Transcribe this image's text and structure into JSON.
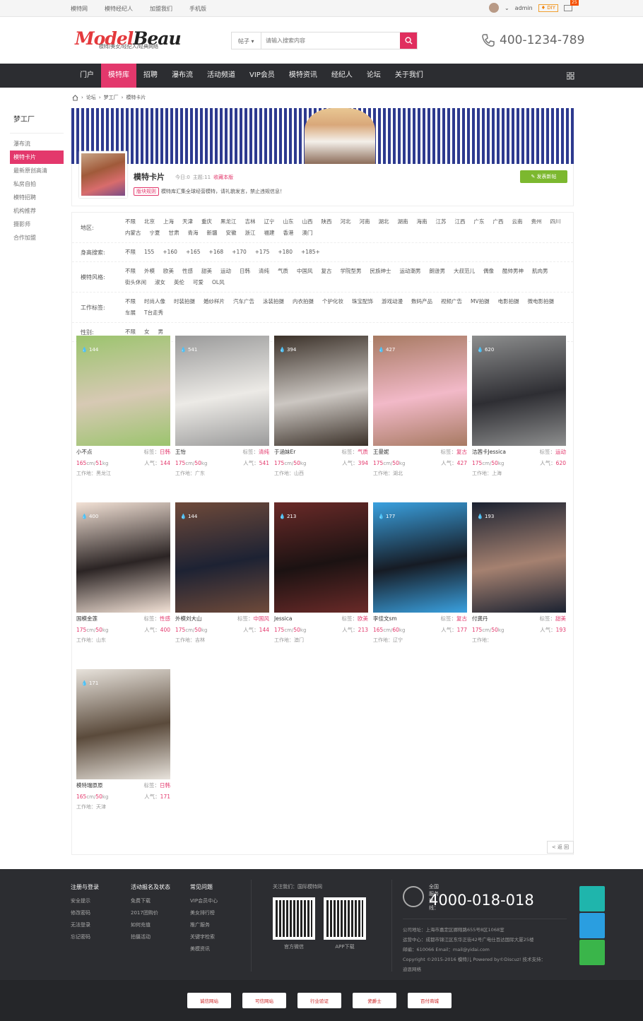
{
  "topbar": {
    "links": [
      "模特网",
      "模特经纪人",
      "加盟我们",
      "手机版"
    ],
    "user": "admin",
    "diy": "DIY",
    "mail_count": "25"
  },
  "header": {
    "logo": "ModelBeau",
    "logo_a": "Model",
    "logo_b": "Beau",
    "tagline": "模特/美女/经纪人/经典网络",
    "search_type": "帖子",
    "search_placeholder": "请输入搜索内容",
    "phone": "400-1234-789"
  },
  "nav": [
    "门户",
    "模特库",
    "招聘",
    "瀑布流",
    "活动频道",
    "VIP会员",
    "模特资讯",
    "经纪人",
    "论坛",
    "关于我们"
  ],
  "sidebar": {
    "title": "梦工厂",
    "items": [
      "瀑布流",
      "模特卡片",
      "最新原创高清",
      "私房自拍",
      "模特招聘",
      "机构推荐",
      "摄影师",
      "合作加盟"
    ]
  },
  "breadcrumb": [
    "论坛",
    "梦工厂",
    "模特卡片"
  ],
  "forum": {
    "title": "模特卡片",
    "today": "今日:0",
    "topics": "主题:11",
    "fav": "收藏本版",
    "rules_tag": "版块规则",
    "rules": "模特库汇集全球经营模特，请礼貌发言，禁止违规信息！",
    "post_btn": "发表新帖"
  },
  "filters": [
    {
      "label": "地区:",
      "opts": [
        "不限",
        "北京",
        "上海",
        "天津",
        "重庆",
        "黑龙江",
        "吉林",
        "辽宁",
        "山东",
        "山西",
        "陕西",
        "河北",
        "河南",
        "湖北",
        "湖南",
        "海南",
        "江苏",
        "江西",
        "广东",
        "广西",
        "云南",
        "贵州",
        "四川",
        "内蒙古",
        "宁夏",
        "甘肃",
        "青海",
        "新疆",
        "安徽",
        "浙江",
        "福建",
        "香港",
        "澳门"
      ]
    },
    {
      "label": "身高搜索:",
      "opts": [
        "不限",
        "155",
        "+160",
        "+165",
        "+168",
        "+170",
        "+175",
        "+180",
        "+185+"
      ]
    },
    {
      "label": "模特风格:",
      "opts": [
        "不限",
        "外模",
        "欧美",
        "性感",
        "甜美",
        "运动",
        "日韩",
        "清纯",
        "气质",
        "中国风",
        "复古",
        "学院型男",
        "民族绅士",
        "运动潮男",
        "朗逊男",
        "大叔范儿",
        "偶像",
        "酷帅男神",
        "肌肉男",
        "街头休闲",
        "淑女",
        "英伦",
        "可爱",
        "OL风"
      ]
    },
    {
      "label": "工作标签:",
      "opts": [
        "不限",
        "时尚人像",
        "时装拍摄",
        "婚纱样片",
        "汽车广告",
        "泳装拍摄",
        "内衣拍摄",
        "个护化妆",
        "珠宝配饰",
        "游戏动漫",
        "数码产品",
        "视频广告",
        "MV拍摄",
        "电影拍摄",
        "微电影拍摄",
        "车展",
        "T台走秀"
      ]
    },
    {
      "label": "性别:",
      "opts": [
        "不限",
        "女",
        "男"
      ]
    }
  ],
  "cards": [
    {
      "likes": "144",
      "name": "小不点",
      "tag_label": "标签：",
      "tag": "日韩",
      "h": "165",
      "w": "51",
      "pop_label": "人气：",
      "pop": "144",
      "area": "工作地：黑龙江",
      "c1": "#9bc46d",
      "c2": "#d7c9b4"
    },
    {
      "likes": "541",
      "name": "王怡",
      "tag_label": "标签：",
      "tag": "清纯",
      "h": "175",
      "w": "50",
      "pop_label": "人气：",
      "pop": "541",
      "area": "工作地：广东",
      "c1": "#9a9a9a",
      "c2": "#eceae6"
    },
    {
      "likes": "394",
      "name": "于涵妹Er",
      "tag_label": "标签：",
      "tag": "气质",
      "h": "175",
      "w": "50",
      "pop_label": "人气：",
      "pop": "394",
      "area": "工作地：山西",
      "c1": "#3a3028",
      "c2": "#ccc7c2"
    },
    {
      "likes": "427",
      "name": "王曼妮",
      "tag_label": "标签：",
      "tag": "复古",
      "h": "175",
      "w": "50",
      "pop_label": "人气：",
      "pop": "427",
      "area": "工作地：湖北",
      "c1": "#a77a62",
      "c2": "#f2b9c8"
    },
    {
      "likes": "620",
      "name": "洁茜卡Jessica",
      "tag_label": "标签：",
      "tag": "运动",
      "h": "175",
      "w": "50",
      "pop_label": "人气：",
      "pop": "620",
      "area": "工作地：上海",
      "c1": "#8d8e8e",
      "c2": "#2e2e33"
    },
    {
      "likes": "400",
      "name": "国模金莲",
      "tag_label": "标签：",
      "tag": "性感",
      "h": "175",
      "w": "50",
      "pop_label": "人气：",
      "pop": "400",
      "area": "工作地：山东",
      "c1": "#f3e2d6",
      "c2": "#2b2424"
    },
    {
      "likes": "144",
      "name": "外模刘大山",
      "tag_label": "标签：",
      "tag": "中国风",
      "h": "175",
      "w": "50",
      "pop_label": "人气：",
      "pop": "144",
      "area": "工作地：吉林",
      "c1": "#6f4a3a",
      "c2": "#1d2233"
    },
    {
      "likes": "213",
      "name": "Jessica",
      "tag_label": "标签：",
      "tag": "欧美",
      "h": "175",
      "w": "50",
      "pop_label": "人气：",
      "pop": "213",
      "area": "工作地：澳门",
      "c1": "#6a2a28",
      "c2": "#1b1212"
    },
    {
      "likes": "177",
      "name": "李佳文sm",
      "tag_label": "标签：",
      "tag": "复古",
      "h": "165",
      "w": "60",
      "pop_label": "人气：",
      "pop": "177",
      "area": "工作地：辽宁",
      "c1": "#3aa1e0",
      "c2": "#161b24"
    },
    {
      "likes": "193",
      "name": "付龚丹",
      "tag_label": "标签：",
      "tag": "甜美",
      "h": "175",
      "w": "50",
      "pop_label": "人气：",
      "pop": "193",
      "area": "工作地：",
      "c1": "#1b2231",
      "c2": "#a58170"
    },
    {
      "likes": "171",
      "name": "模特瑞原原",
      "tag_label": "标签：",
      "tag": "日韩",
      "h": "165",
      "w": "50",
      "pop_label": "人气：",
      "pop": "171",
      "area": "工作地：天津",
      "c1": "#e8e3dc",
      "c2": "#5a4a3b"
    }
  ],
  "back": "< 返 回",
  "footer": {
    "cols": [
      {
        "h": "注册与登录",
        "items": [
          "安全提示",
          "修改密码",
          "无法登录",
          "忘记密码"
        ]
      },
      {
        "h": "活动报名及状态",
        "items": [
          "免费下载",
          "2017团购价",
          "如何充值",
          "拍摄活动"
        ]
      },
      {
        "h": "常见问题",
        "items": [
          "VIP会员中心",
          "美女排行榜",
          "推广服务",
          "关键字检索",
          "美模资讯"
        ]
      }
    ],
    "follow": "关注我们：国际模特网",
    "qr1": "官方微信",
    "qr2": "APP下载",
    "hotline_label": "全国服务热线：",
    "hotline": "4000-018-018",
    "addr": [
      "公司地址：上海市嘉定区娜翔路655号8区1068室",
      "运营中心：成都市锦江区东华正街42号广电仕百达国际大厦25楼",
      "邮编：610066 Email：mail@yidai.com",
      "Copyright ©2015-2016 模特儿 Powered by©Discuz! 技术支持：",
      "迪恩网络"
    ],
    "badges": [
      "诚信网站",
      "可信网站",
      "行业验证",
      "瓷爵士",
      "百付商城"
    ]
  }
}
